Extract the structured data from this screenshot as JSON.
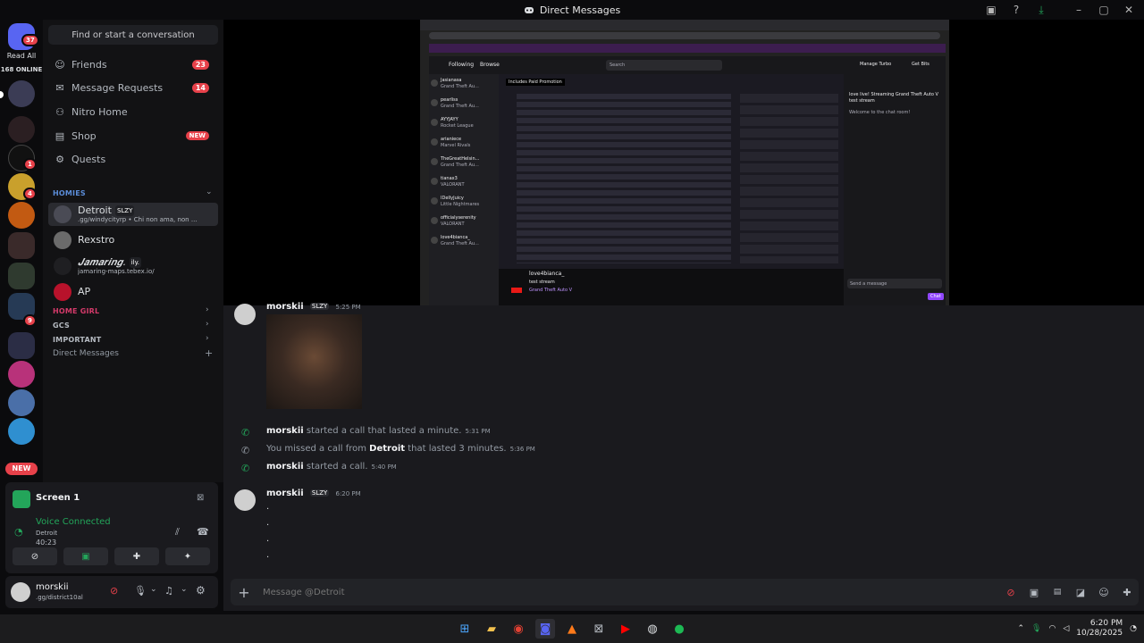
{
  "window": {
    "title": "Direct Messages"
  },
  "servers": {
    "read_all": "Read All",
    "online": "168 ONLINE",
    "home_badge": "37",
    "new_label": "NEW",
    "badges": {
      "s1": "1",
      "s2": "4",
      "s3": "9"
    }
  },
  "sidebar": {
    "find": "Find or start a conversation",
    "nav": [
      {
        "label": "Friends",
        "count": "23"
      },
      {
        "label": "Message Requests",
        "count": "14"
      },
      {
        "label": "Nitro Home",
        "count": ""
      },
      {
        "label": "Shop",
        "count": "NEW"
      },
      {
        "label": "Quests",
        "count": ""
      }
    ],
    "cats": {
      "homies": "HOMIES",
      "home_girl": "HOME GIRL",
      "gcs": "GCS",
      "important": "IMPORTANT",
      "dm": "Direct Messages"
    },
    "dms": [
      {
        "name": "Detroit",
        "tag": "SLZY",
        "sub": ".gg/windycityrp • Chi non ama, non ..."
      },
      {
        "name": "Rexstro",
        "tag": "",
        "sub": ""
      },
      {
        "name": "𝑱𝒂𝒎𝒂𝒓𝒊𝒏𝒈.",
        "tag": "ily.",
        "sub": "jamaring-maps.tebex.io/"
      },
      {
        "name": "AP",
        "tag": "",
        "sub": ""
      }
    ]
  },
  "voice": {
    "screen": "Screen 1",
    "status": "Voice Connected",
    "channel": "Detroit",
    "timer": "40:23"
  },
  "user": {
    "name": "morskii",
    "sub": ".gg/district10al"
  },
  "stream": {
    "tabs": [
      "Following",
      "Browse"
    ],
    "search": "Search",
    "promo": "Includes Paid Promotion",
    "streamer": "love4bianca_",
    "stream_title": "test stream",
    "game": "Grand Theft Auto V",
    "buttons": {
      "turbo": "Manage Turbo",
      "bits": "Get Bits",
      "chat": "Chat"
    },
    "chat_msg": "love live! Streaming Grand Theft Auto V test stream",
    "welcome": "Welcome to the chat room!",
    "send": "Send a message",
    "channels": [
      {
        "n": "Jasianasa",
        "g": "Grand Theft Au..."
      },
      {
        "n": "pearliss",
        "g": "Grand Theft Au..."
      },
      {
        "n": "AYYJAYY",
        "g": "Rocket League"
      },
      {
        "n": "arianiece",
        "g": "Marvel Rivals"
      },
      {
        "n": "TheGreatHelsin...",
        "g": "Grand Theft Au..."
      },
      {
        "n": "tianax3",
        "g": "VALORANT"
      },
      {
        "n": "IDellyJuicy",
        "g": "Little Nightmares"
      },
      {
        "n": "officialyserenity",
        "g": "VALORANT"
      },
      {
        "n": "love4bianca_",
        "g": "Grand Theft Au..."
      }
    ]
  },
  "messages": [
    {
      "type": "header",
      "author": "morskii",
      "tag": "SLZY",
      "time": "5:25 PM"
    },
    {
      "type": "call",
      "text1": "morskii",
      "text2": " started a call that lasted a minute.",
      "time": "5:31 PM"
    },
    {
      "type": "missed",
      "text1": "You missed a call from ",
      "text2": "Detroit",
      "text3": " that lasted 3 minutes.",
      "time": "5:36 PM"
    },
    {
      "type": "call",
      "text1": "morskii",
      "text2": " started a call.",
      "time": "5:40 PM"
    },
    {
      "type": "header",
      "author": "morskii",
      "tag": "SLZY",
      "time": "6:20 PM"
    }
  ],
  "dots": [
    ".",
    ".",
    ".",
    "."
  ],
  "composer": {
    "placeholder": "Message @Detroit"
  },
  "taskbar": {
    "time": "6:20 PM",
    "date": "10/28/2025"
  },
  "colors": {
    "accent": "#5865f2",
    "red": "#e7414a",
    "green": "#23a55a"
  }
}
